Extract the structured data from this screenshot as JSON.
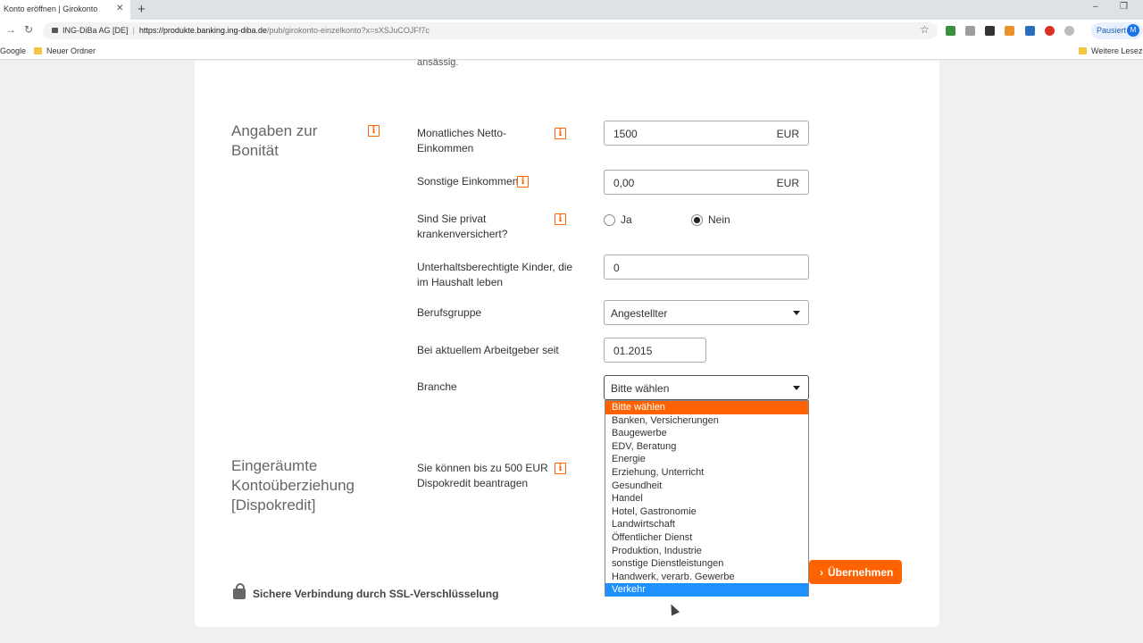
{
  "browser": {
    "tab_title": "Konto eröffnen | Girokonto",
    "tab_close": "✕",
    "new_tab": "+",
    "site_identity": "ING-DiBa AG [DE]",
    "url_host": "https://produkte.banking.ing-diba.de",
    "url_path": "/pub/girokonto-einzelkonto?x=sXSJuCOJFf7c",
    "profile_status": "Pausiert",
    "profile_initial": "M",
    "bookmarks": [
      "Google",
      "Neuer Ordner",
      "Weitere Lesezei"
    ]
  },
  "form": {
    "cutoff_text": "ansässig.",
    "sections": {
      "bonitaet_title_line1": "Angaben zur",
      "bonitaet_title_line2": "Bonität",
      "dispo_title_line1": "Eingeräumte",
      "dispo_title_line2": "Kontoüberziehung",
      "dispo_title_line3": "[Dispokredit]"
    },
    "income": {
      "label_line1": "Monatliches Netto-",
      "label_line2": "Einkommen",
      "value": "1500",
      "unit": "EUR"
    },
    "other_income": {
      "label": "Sonstige Einkommen",
      "value": "0,00",
      "unit": "EUR"
    },
    "private_insurance": {
      "label_line1": "Sind Sie privat",
      "label_line2": "krankenversichert?",
      "option_yes": "Ja",
      "option_no": "Nein",
      "selected": "Nein"
    },
    "children": {
      "label_line1": "Unterhaltsberechtigte Kinder, die",
      "label_line2": "im Haushalt leben",
      "value": "0"
    },
    "profession": {
      "label": "Berufsgruppe",
      "value": "Angestellter"
    },
    "employer_since": {
      "label": "Bei aktuellem Arbeitgeber seit",
      "value": "01.2015"
    },
    "industry": {
      "label": "Branche",
      "value": "Bitte wählen",
      "options": [
        "Bitte wählen",
        "Banken, Versicherungen",
        "Baugewerbe",
        "EDV, Beratung",
        "Energie",
        "Erziehung, Unterricht",
        "Gesundheit",
        "Handel",
        "Hotel, Gastronomie",
        "Landwirtschaft",
        "Öffentlicher Dienst",
        "Produktion, Industrie",
        "sonstige Dienstleistungen",
        "Handwerk, verarb. Gewerbe",
        "Verkehr"
      ]
    },
    "dispo": {
      "label_line1": "Sie können bis zu 500 EUR",
      "label_line2": "Dispokredit beantragen"
    },
    "apply_button": "Übernehmen",
    "ssl_note": "Sichere Verbindung durch SSL-Verschlüsselung"
  },
  "colors": {
    "accent": "#ff6200",
    "highlight": "#1e90ff"
  }
}
